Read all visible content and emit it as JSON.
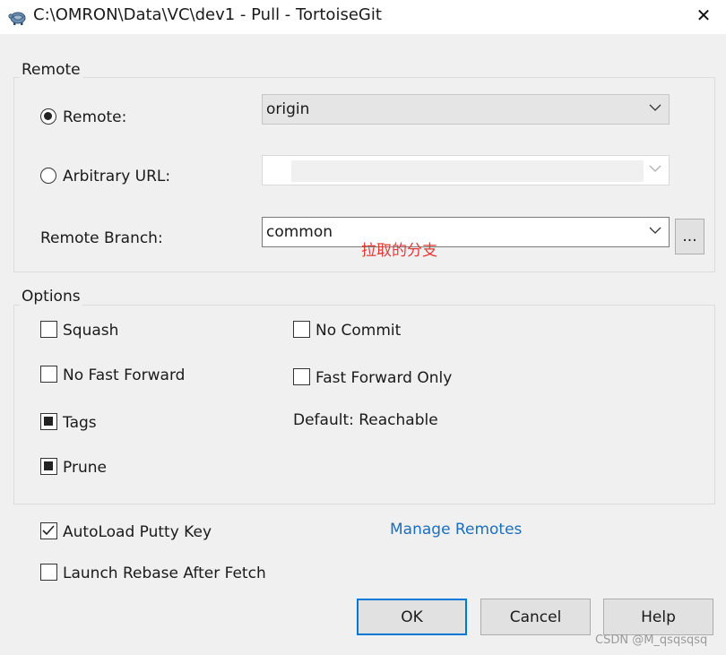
{
  "window": {
    "title": "C:\\OMRON\\Data\\VC\\dev1 - Pull - TortoiseGit",
    "app_icon": "tortoise-icon",
    "close_symbol": "✕"
  },
  "remote_group": {
    "legend": "Remote",
    "remote_radio_label": "Remote:",
    "remote_value": "origin",
    "arbitrary_url_label": "Arbitrary URL:",
    "arbitrary_url_value": "",
    "remote_branch_label": "Remote Branch:",
    "remote_branch_value": "common",
    "browse_button_label": "...",
    "annotation": "拉取的分支"
  },
  "options_group": {
    "legend": "Options",
    "squash": {
      "label": "Squash",
      "state": "unchecked"
    },
    "no_fast_forward": {
      "label": "No Fast Forward",
      "state": "unchecked"
    },
    "tags": {
      "label": "Tags",
      "state": "indeterminate"
    },
    "prune": {
      "label": "Prune",
      "state": "indeterminate"
    },
    "no_commit": {
      "label": "No Commit",
      "state": "unchecked"
    },
    "fast_forward_only": {
      "label": "Fast Forward Only",
      "state": "unchecked"
    },
    "default_text": "Default: Reachable"
  },
  "autoload_putty": {
    "label": "AutoLoad Putty Key",
    "state": "checked"
  },
  "launch_rebase": {
    "label": "Launch Rebase After Fetch",
    "state": "unchecked"
  },
  "manage_remotes_link": "Manage Remotes",
  "buttons": {
    "ok": "OK",
    "cancel": "Cancel",
    "help": "Help"
  },
  "watermark": "CSDN @M_qsqsqsq",
  "colors": {
    "accent": "#0078d7",
    "link": "#1a6fbf",
    "annotation": "#e53935"
  }
}
